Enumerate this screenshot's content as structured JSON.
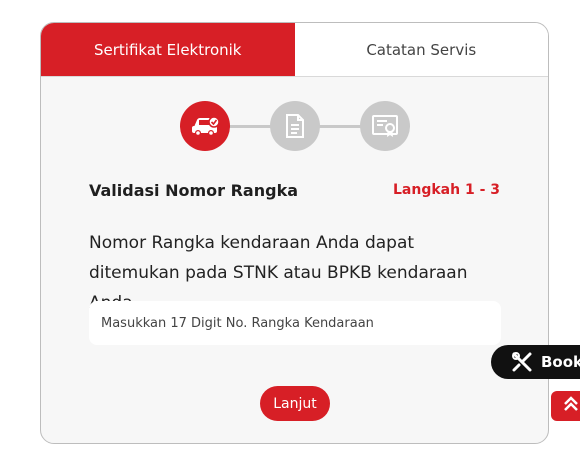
{
  "tabs": [
    {
      "label": "Sertifikat Elektronik",
      "active": true
    },
    {
      "label": "Catatan Servis",
      "active": false
    }
  ],
  "steps": {
    "icons": [
      "car-check-icon",
      "document-icon",
      "certificate-icon"
    ],
    "current": 1,
    "total": 3
  },
  "form": {
    "title": "Validasi Nomor Rangka",
    "step_label": "Langkah 1 - 3",
    "description": "Nomor Rangka kendaraan Anda dapat ditemukan pada STNK atau BPKB kendaraan Anda",
    "input_placeholder": "Masukkan 17 Digit No. Rangka Kendaraan",
    "submit_label": "Lanjut"
  },
  "floating": {
    "book_label": "Book"
  },
  "colors": {
    "accent": "#d71f26",
    "inactive_step": "#c9c9c9",
    "card_bg": "#f7f7f7"
  }
}
